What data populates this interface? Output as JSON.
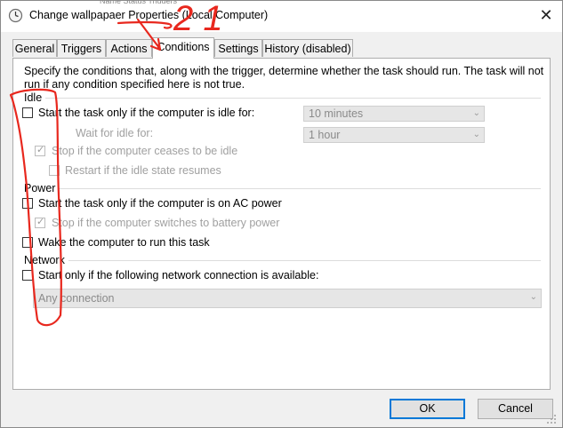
{
  "window": {
    "title": "Change wallpapaer Properties (Local Computer)",
    "close_glyph": "✕",
    "residue_text": "Name           Status      Triggers",
    "icon": "task-scheduler-clock-icon"
  },
  "tabs": [
    {
      "label": "General"
    },
    {
      "label": "Triggers"
    },
    {
      "label": "Actions"
    },
    {
      "label": "Conditions",
      "active": true
    },
    {
      "label": "Settings"
    },
    {
      "label": "History (disabled)"
    }
  ],
  "conditions": {
    "intro_line1": "Specify the conditions that, along with the trigger, determine whether the task should run.  The task will not",
    "intro_line2": "run  if any condition specified here is not true.",
    "idle": {
      "header": "Idle",
      "start_if_idle": {
        "label": "Start the task only if the computer is idle for:",
        "checked": false
      },
      "idle_duration": {
        "value": "10 minutes",
        "enabled": false
      },
      "wait_label": "Wait for idle for:",
      "wait_duration": {
        "value": "1 hour",
        "enabled": false
      },
      "stop_if_not_idle": {
        "label": "Stop if the computer ceases to be idle",
        "checked": true,
        "enabled": false
      },
      "restart_if_idle": {
        "label": "Restart if the idle state resumes",
        "checked": false,
        "enabled": false
      }
    },
    "power": {
      "header": "Power",
      "ac_power": {
        "label": "Start the task only if the computer is on AC power",
        "checked": false
      },
      "stop_on_battery": {
        "label": "Stop if the computer switches to battery power",
        "checked": true,
        "enabled": false
      },
      "wake": {
        "label": "Wake the computer to run this task",
        "checked": false
      }
    },
    "network": {
      "header": "Network",
      "network_available": {
        "label": "Start only if the following network connection is available:",
        "checked": false
      },
      "connection": {
        "value": "Any connection",
        "enabled": false
      }
    }
  },
  "buttons": {
    "ok": "OK",
    "cancel": "Cancel"
  },
  "annotation": {
    "scribble_text": "2 1",
    "color": "#e8281e"
  },
  "colors": {
    "accent": "#0078d7",
    "annotation": "#e8281e"
  }
}
